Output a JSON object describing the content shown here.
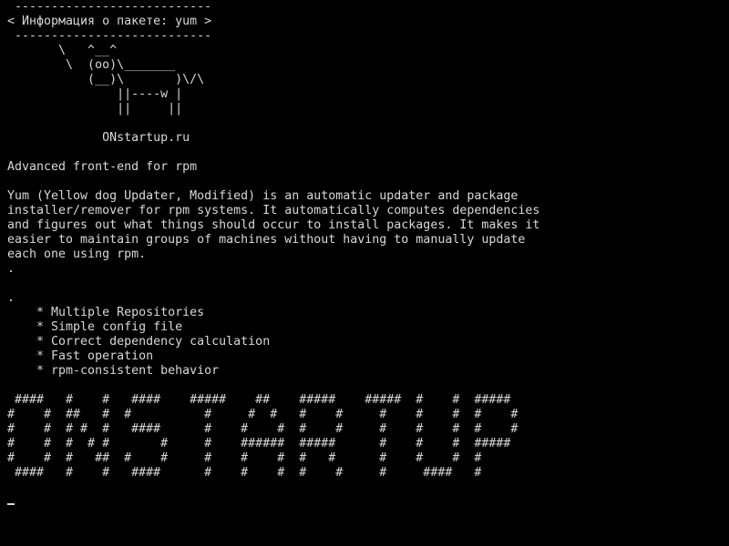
{
  "terminal": {
    "lines": [
      " ---------------------------",
      "< Информация о пакете: yum >",
      " ---------------------------",
      "       \\   ^__^",
      "        \\  (oo)\\_______",
      "           (__)\\       )\\/\\",
      "               ||----w |",
      "               ||     ||",
      "",
      "             ONstartup.ru",
      "",
      "Advanced front-end for rpm",
      "",
      "Yum (Yellow dog Updater, Modified) is an automatic updater and package",
      "installer/remover for rpm systems. It automatically computes dependencies",
      "and figures out what things should occur to install packages. It makes it",
      "easier to maintain groups of machines without having to manually update",
      "each one using rpm.",
      ".",
      "",
      ".",
      "    * Multiple Repositories",
      "    * Simple config file",
      "    * Correct dependency calculation",
      "    * Fast operation",
      "    * rpm-consistent behavior",
      "",
      " ####   #    #   ####    #####    ##    #####    #####  #    #  #####",
      "#    #  ##   #  #          #     #  #   #    #     #    #    #  #    #",
      "#    #  # #  #   ####      #    #    #  #    #     #    #    #  #    #",
      "#    #  #  # #       #     #    ######  #####      #    #    #  #####",
      "#    #  #   ##  #    #     #    #    #  #   #      #    #    #  #",
      " ####   #    #   ####      #    #    #  #    #     #     ####   #",
      "",
      ""
    ]
  },
  "colors": {
    "background": "#000000",
    "foreground": "#d8d8d8"
  }
}
